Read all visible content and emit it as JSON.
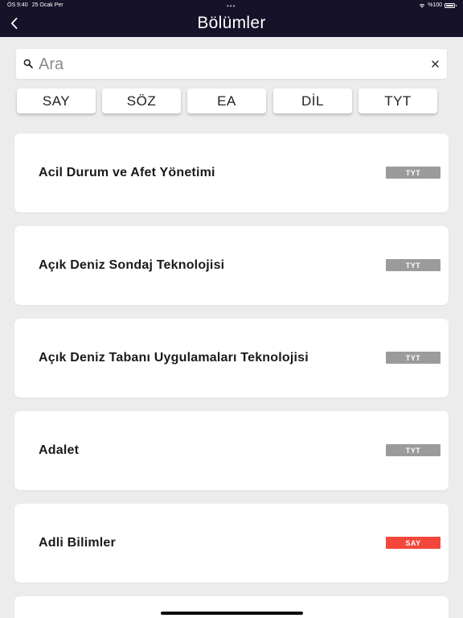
{
  "status_bar": {
    "time": "ÖS 9:40",
    "date": "25 Ocak Per",
    "dots": "•••",
    "battery": "%100"
  },
  "header": {
    "title": "Bölümler"
  },
  "search": {
    "placeholder": "Ara",
    "value": ""
  },
  "filters": [
    {
      "label": "SAY"
    },
    {
      "label": "SÖZ"
    },
    {
      "label": "EA"
    },
    {
      "label": "DİL"
    },
    {
      "label": "TYT"
    }
  ],
  "departments": [
    {
      "name": "Acil Durum ve Afet Yönetimi",
      "type": "TYT"
    },
    {
      "name": "Açık Deniz Sondaj Teknolojisi",
      "type": "TYT"
    },
    {
      "name": "Açık Deniz Tabanı Uygulamaları Teknolojisi",
      "type": "TYT"
    },
    {
      "name": "Adalet",
      "type": "TYT"
    },
    {
      "name": "Adli Bilimler",
      "type": "SAY"
    },
    {
      "name": "",
      "type": ""
    }
  ],
  "colors": {
    "header_bg": "#151229",
    "badge_tyt": "#9b9b9b",
    "badge_say": "#f2473a",
    "page_bg": "#ececec"
  },
  "icons": {
    "back": "chevron-left-icon",
    "search": "search-icon",
    "clear": "close-icon",
    "wifi": "wifi-icon",
    "battery": "battery-icon"
  }
}
